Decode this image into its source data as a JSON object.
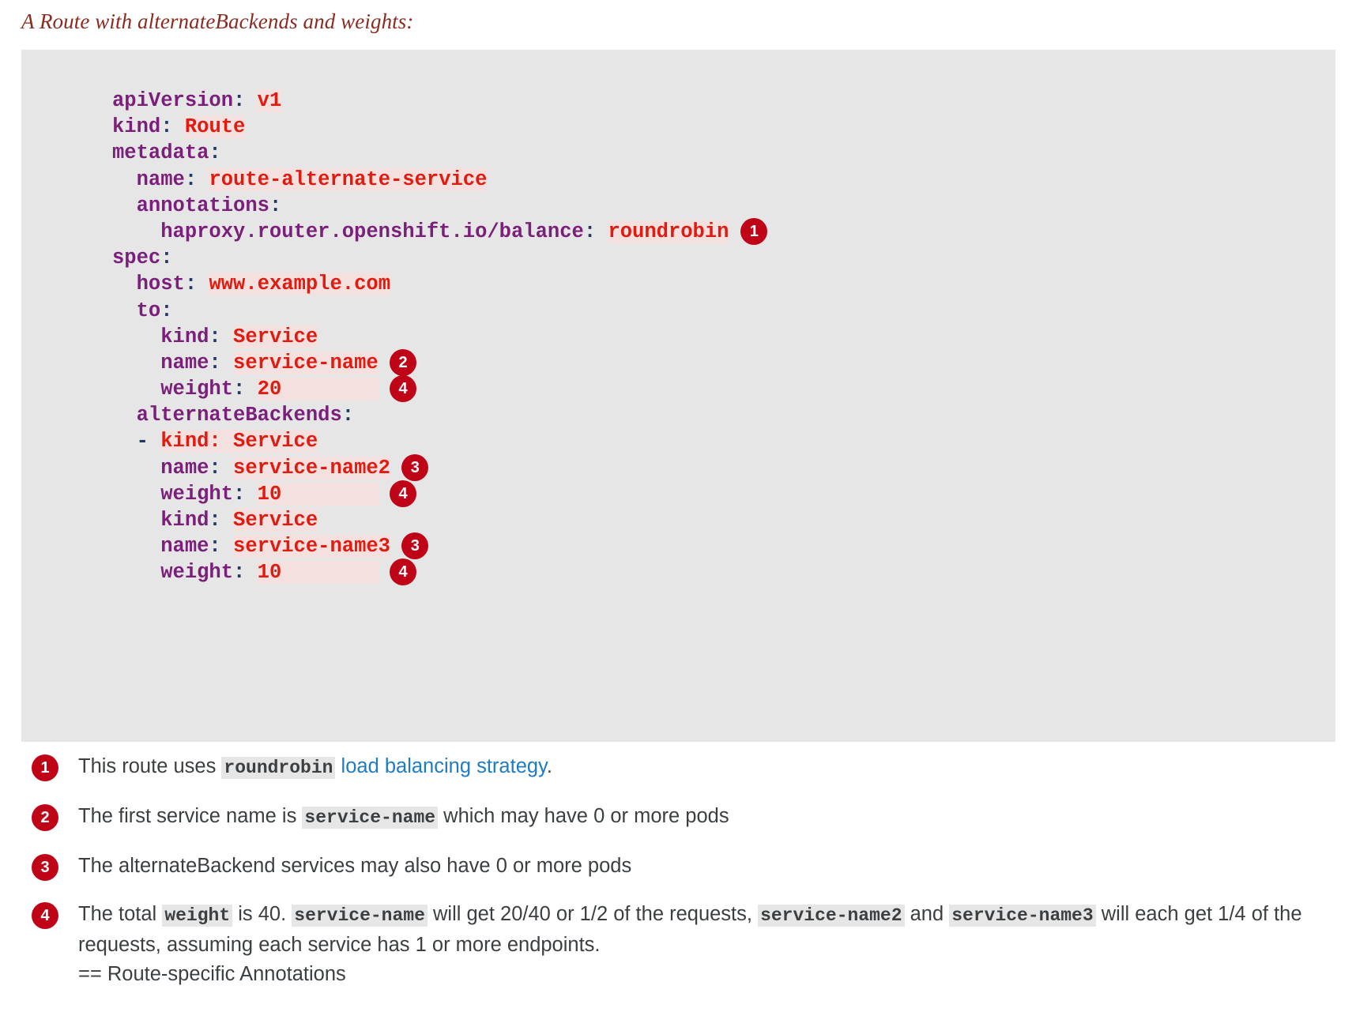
{
  "title": "A Route with alternateBackends and weights:",
  "colors": {
    "title": "#8a2b22",
    "code_bg": "#e6e6e6",
    "badge": "#c00418",
    "yaml_key": "#7a1f7a",
    "yaml_value": "#e01b10",
    "value_highlight": "#f5e0e0",
    "link": "#1f7cc2",
    "body_text": "#3c3f41"
  },
  "code": {
    "language": "yaml",
    "lines": [
      {
        "indent": 0,
        "key": "apiVersion",
        "value": "v1"
      },
      {
        "indent": 0,
        "key": "kind",
        "value": "Route"
      },
      {
        "indent": 0,
        "key": "metadata",
        "value": ""
      },
      {
        "indent": 1,
        "key": "name",
        "value": "route-alternate-service"
      },
      {
        "indent": 1,
        "key": "annotations",
        "value": ""
      },
      {
        "indent": 2,
        "key": "haproxy.router.openshift.io/balance",
        "value": "roundrobin",
        "callout": "1"
      },
      {
        "indent": 0,
        "key": "spec",
        "value": ""
      },
      {
        "indent": 1,
        "key": "host",
        "value": "www.example.com"
      },
      {
        "indent": 1,
        "key": "to",
        "value": ""
      },
      {
        "indent": 2,
        "key": "kind",
        "value": "Service"
      },
      {
        "indent": 2,
        "key": "name",
        "value": "service-name",
        "callout": "2"
      },
      {
        "indent": 2,
        "key": "weight",
        "value": "20",
        "callout": "4"
      },
      {
        "indent": 1,
        "key": "alternateBackends",
        "value": ""
      },
      {
        "indent": 1,
        "dash": "-",
        "key": "kind",
        "value": "Service",
        "whole_red": true
      },
      {
        "indent": 2,
        "key": "name",
        "value": "service-name2",
        "callout": "3"
      },
      {
        "indent": 2,
        "key": "weight",
        "value": "10",
        "callout": "4"
      },
      {
        "indent": 2,
        "key": "kind",
        "value": "Service"
      },
      {
        "indent": 2,
        "key": "name",
        "value": "service-name3",
        "callout": "3"
      },
      {
        "indent": 2,
        "key": "weight",
        "value": "10",
        "callout": "4"
      }
    ],
    "raw": "apiVersion: v1\nkind: Route\nmetadata:\n  name: route-alternate-service\n  annotations:\n    haproxy.router.openshift.io/balance: roundrobin\nspec:\n  host: www.example.com\n  to:\n    kind: Service\n    name: service-name\n    weight: 20\n  alternateBackends:\n  - kind: Service\n    name: service-name2\n    weight: 10\n    kind: Service\n    name: service-name3\n    weight: 10"
  },
  "callouts": [
    {
      "num": "1",
      "parts": [
        {
          "type": "text",
          "text": "This route uses "
        },
        {
          "type": "code",
          "text": "roundrobin"
        },
        {
          "type": "text",
          "text": " "
        },
        {
          "type": "link",
          "text": "load balancing strategy"
        },
        {
          "type": "text",
          "text": "."
        }
      ]
    },
    {
      "num": "2",
      "parts": [
        {
          "type": "text",
          "text": "The first service name is "
        },
        {
          "type": "code",
          "text": "service-name"
        },
        {
          "type": "text",
          "text": " which may have 0 or more pods"
        }
      ]
    },
    {
      "num": "3",
      "parts": [
        {
          "type": "text",
          "text": "The alternateBackend services may also have 0 or more pods"
        }
      ]
    },
    {
      "num": "4",
      "parts": [
        {
          "type": "text",
          "text": "The total "
        },
        {
          "type": "code",
          "text": "weight"
        },
        {
          "type": "text",
          "text": " is 40. "
        },
        {
          "type": "code",
          "text": "service-name"
        },
        {
          "type": "text",
          "text": " will get 20/40 or 1/2 of the requests, "
        },
        {
          "type": "code",
          "text": "service-name2"
        },
        {
          "type": "text",
          "text": " and "
        },
        {
          "type": "code",
          "text": "service-name3"
        },
        {
          "type": "text",
          "text": " will each get 1/4 of the requests, assuming each service has 1 or more endpoints."
        },
        {
          "type": "break"
        },
        {
          "type": "text",
          "text": "== Route-specific Annotations"
        }
      ]
    }
  ]
}
